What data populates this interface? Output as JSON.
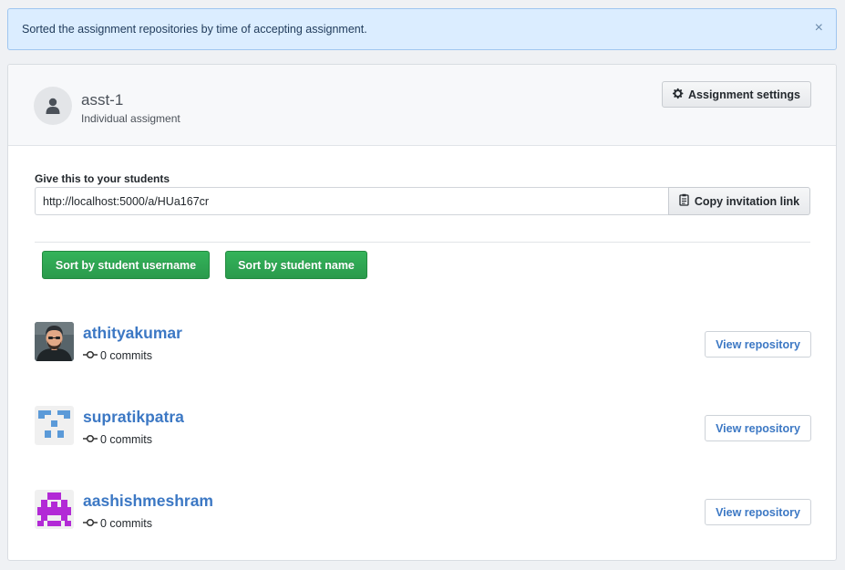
{
  "flash": {
    "message": "Sorted the assignment repositories by time of accepting assignment.",
    "close_glyph": "×"
  },
  "assignment": {
    "title": "asst-1",
    "type": "Individual assigment",
    "settings_label": "Assignment settings",
    "avatar_icon": "person-icon"
  },
  "invitation": {
    "label": "Give this to your students",
    "link": "http://localhost:5000/a/HUa167cr",
    "copy_label": "Copy invitation link",
    "copy_icon": "clipboard-icon"
  },
  "sort": {
    "by_username_label": "Sort by student username",
    "by_name_label": "Sort by student name"
  },
  "students": [
    {
      "username": "athityakumar",
      "commits": "0 commits",
      "action_label": "View repository",
      "avatar": "photo-avatar"
    },
    {
      "username": "supratikpatra",
      "commits": "0 commits",
      "action_label": "View repository",
      "avatar": "identicon-blue"
    },
    {
      "username": "aashishmeshram",
      "commits": "0 commits",
      "action_label": "View repository",
      "avatar": "identicon-magenta"
    }
  ],
  "colors": {
    "flash_bg": "#dbedff",
    "link_blue": "#3c78c4",
    "primary_green": "#2ea44f",
    "identicon_blue": "#5b9ad8",
    "identicon_magenta": "#b22ad6"
  }
}
